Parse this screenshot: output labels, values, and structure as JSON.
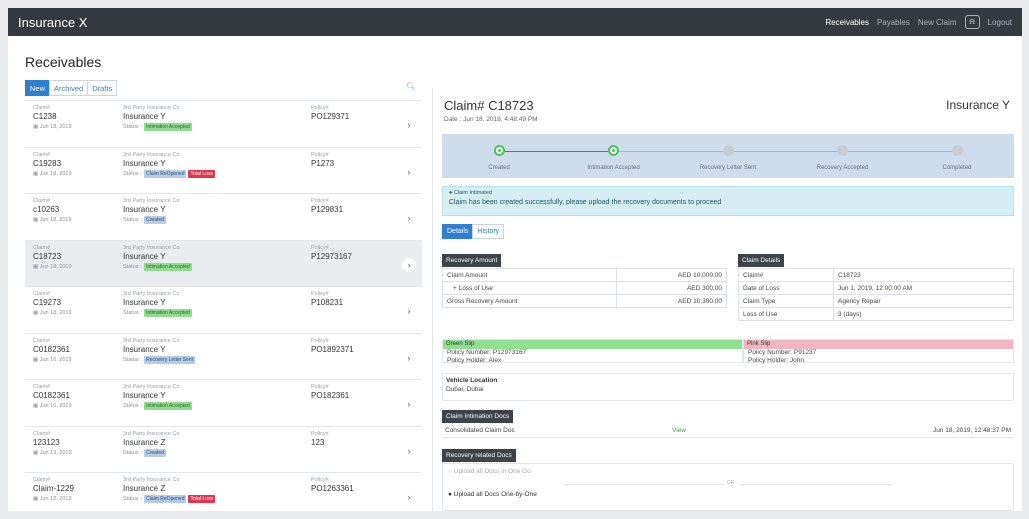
{
  "nav": {
    "brand": "Insurance X",
    "links": [
      "Receivables",
      "Payables",
      "New Claim"
    ],
    "logout": "Logout"
  },
  "page_title": "Receivables",
  "list_tabs": [
    "New",
    "Archived",
    "Drafts"
  ],
  "claims": [
    {
      "claim_label": "Claim#",
      "claim_no": "C1238",
      "date": "Jun 18, 2019",
      "ins_label": "3rd Party Insurance Co",
      "insurer": "Insurance Y",
      "status_label": "Status",
      "badges": [
        {
          "text": "Intimation Accepted",
          "color": "#8fdc8f",
          "text_color": "#256c25"
        }
      ],
      "policy_label": "Policy#",
      "policy": "PO129371"
    },
    {
      "claim_label": "Claim#",
      "claim_no": "C19283",
      "date": "Jun 18, 2019",
      "ins_label": "3rd Party Insurance Co",
      "insurer": "Insurance Y",
      "status_label": "Status",
      "badges": [
        {
          "text": "Claim ReOpened",
          "color": "#b6cbe6",
          "text_color": "#2f4f78"
        },
        {
          "text": "Total Loss",
          "color": "#e0344f",
          "text_color": "#ffffff"
        }
      ],
      "policy_label": "Policy#",
      "policy": "P1273"
    },
    {
      "claim_label": "Claim#",
      "claim_no": "c10263",
      "date": "Jun 18, 2019",
      "ins_label": "3rd Party Insurance Co",
      "insurer": "Insurance Y",
      "status_label": "Status",
      "badges": [
        {
          "text": "Created",
          "color": "#b6cbe6",
          "text_color": "#2f4f78"
        }
      ],
      "policy_label": "Policy#",
      "policy": "P129831"
    },
    {
      "claim_label": "Claim#",
      "claim_no": "C18723",
      "date": "Jun 18, 2019",
      "ins_label": "3rd Party Insurance Co",
      "insurer": "Insurance Y",
      "status_label": "Status",
      "badges": [
        {
          "text": "Intimation Accepted",
          "color": "#8fdc8f",
          "text_color": "#256c25"
        }
      ],
      "policy_label": "Policy#",
      "policy": "P12973167",
      "selected": true
    },
    {
      "claim_label": "Claim#",
      "claim_no": "C19273",
      "date": "Jun 18, 2019",
      "ins_label": "3rd Party Insurance Co",
      "insurer": "Insurance Y",
      "status_label": "Status",
      "badges": [
        {
          "text": "Intimation Accepted",
          "color": "#8fdc8f",
          "text_color": "#256c25"
        }
      ],
      "policy_label": "Policy#",
      "policy": "P108231"
    },
    {
      "claim_label": "Claim#",
      "claim_no": "C0182361",
      "date": "Jun 16, 2019",
      "ins_label": "3rd Party Insurance Co",
      "insurer": "Insurance Y",
      "status_label": "Status",
      "badges": [
        {
          "text": "Recovery Letter Sent",
          "color": "#b6cbe6",
          "text_color": "#2f4f78"
        }
      ],
      "policy_label": "Policy#",
      "policy": "PO1892371"
    },
    {
      "claim_label": "Claim#",
      "claim_no": "C0182361",
      "date": "Jun 16, 2019",
      "ins_label": "3rd Party Insurance Co",
      "insurer": "Insurance Y",
      "status_label": "Status",
      "badges": [
        {
          "text": "Intimation Accepted",
          "color": "#8fdc8f",
          "text_color": "#256c25"
        }
      ],
      "policy_label": "Policy#",
      "policy": "PO182361"
    },
    {
      "claim_label": "Claim#",
      "claim_no": "123123",
      "date": "Jun 13, 2019",
      "ins_label": "3rd Party Insurance Co",
      "insurer": "Insurance Z",
      "status_label": "Status",
      "badges": [
        {
          "text": "Created",
          "color": "#b6cbe6",
          "text_color": "#2f4f78"
        }
      ],
      "policy_label": "Policy#",
      "policy": "123"
    },
    {
      "claim_label": "Claim#",
      "claim_no": "Claim-1229",
      "date": "Jun 12, 2019",
      "ins_label": "3rd Party Insurance Co",
      "insurer": "Insurance Z",
      "status_label": "Status",
      "badges": [
        {
          "text": "Claim ReOpened",
          "color": "#b6cbe6",
          "text_color": "#2f4f78"
        },
        {
          "text": "Total Loss",
          "color": "#e0344f",
          "text_color": "#ffffff"
        }
      ],
      "policy_label": "Policy#",
      "policy": "PO1263361"
    }
  ],
  "detail": {
    "title": "Claim# C18723",
    "date": "Date : Jun 18, 2019, 4:48:49 PM",
    "insurer": "Insurance Y",
    "steps": [
      {
        "label": "Created",
        "done": true
      },
      {
        "label": "Intimation Accepted",
        "done": true
      },
      {
        "label": "Recovery Letter Sent",
        "done": false
      },
      {
        "label": "Recovery Accepted",
        "done": false
      },
      {
        "label": "Completed",
        "done": false
      }
    ],
    "alert_title": "Claim Intimated",
    "alert_msg": "Claim has been created successfully, please upload the recovery documents to proceed",
    "tabs": [
      "Details",
      "History"
    ],
    "recovery_header": "Recovery Amount",
    "recovery_rows": [
      {
        "label": "Claim Amount",
        "value": "AED 10,000.00"
      },
      {
        "label": "+ Loss of Use",
        "value": "AED 300.00"
      },
      {
        "label": "Gross Recovery Amount",
        "value": "AED 10,300.00"
      }
    ],
    "claim_header": "Claim Details",
    "claim_rows": [
      {
        "label": "Claim#",
        "value": "C18723"
      },
      {
        "label": "Date of Loss",
        "value": "Jun 1, 2019, 12:00:00 AM"
      },
      {
        "label": "Claim Type",
        "value": "Agency Repair"
      },
      {
        "label": "Loss of Use",
        "value": "3 (days)"
      }
    ],
    "green_slip": {
      "title": "Green Slip",
      "policy": "Policy Number: P12973167",
      "holder": "Policy Holder: Alex",
      "color": "#8fe08f"
    },
    "pink_slip": {
      "title": "Pink Slip",
      "policy": "Policy Number: P91237",
      "holder": "Policy Holder: John",
      "color": "#f2b6c0"
    },
    "vehicle_location_label": "Vehicle Location",
    "vehicle_location": "Dubai, Dubai",
    "intimation_header": "Claim Intimation Docs",
    "doc": {
      "name": "Consolidated Claim Doc",
      "action": "View",
      "date": "Jun 18, 2019, 12:48:37 PM"
    },
    "recovery_docs_header": "Recovery related Docs",
    "upload_all": "Upload all Docs in One Go",
    "or": "OR",
    "upload_each": "Upload all Docs One-by-One"
  }
}
